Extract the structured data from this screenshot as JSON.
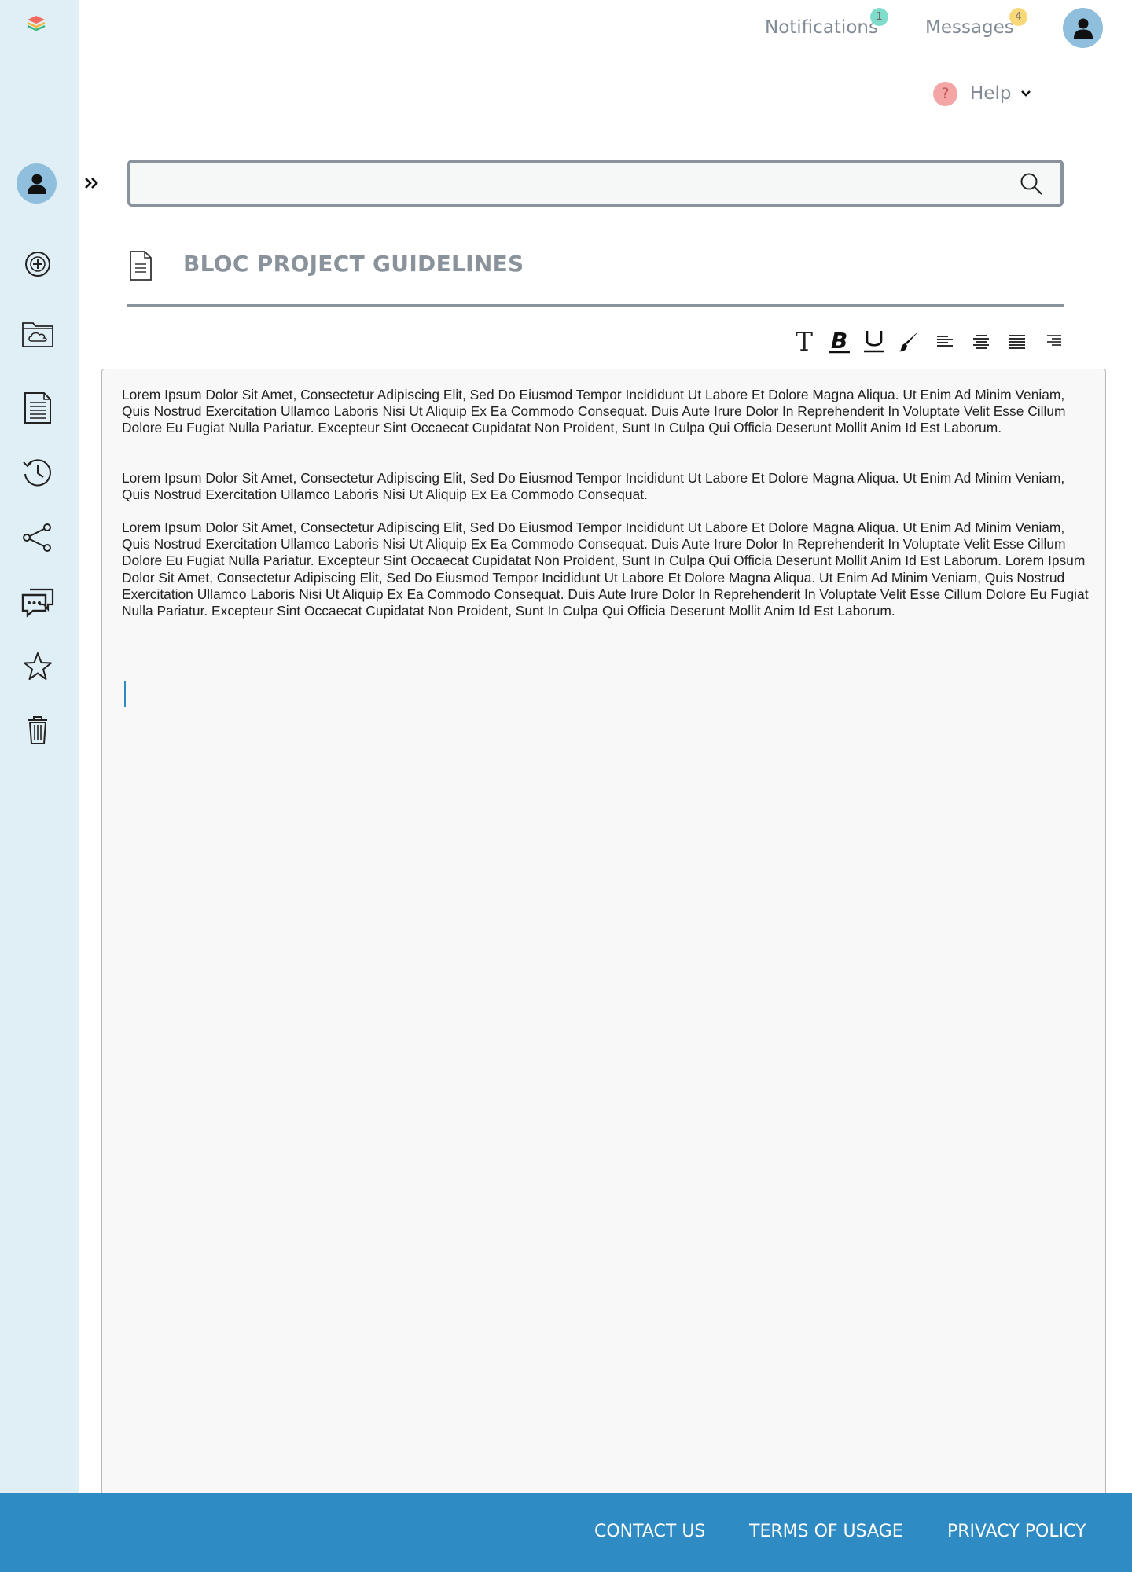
{
  "header": {
    "notifications_label": "Notifications",
    "notifications_count": "1",
    "messages_label": "Messages",
    "messages_count": "4",
    "help_label": "Help",
    "help_icon_text": "?"
  },
  "colors": {
    "sidebar_bg": "#e0eef6",
    "accent": "#2f8bc3",
    "avatar_bg": "#8fbfdc",
    "notification_badge": "#7fdccb",
    "message_badge": "#f8d878",
    "help_icon_bg": "#f4a6a6"
  },
  "sidebar": {
    "items": [
      {
        "name": "new",
        "icon": "plus-circle-icon"
      },
      {
        "name": "cloud-folder",
        "icon": "cloud-folder-icon"
      },
      {
        "name": "documents",
        "icon": "document-list-icon"
      },
      {
        "name": "history",
        "icon": "history-icon"
      },
      {
        "name": "share",
        "icon": "share-icon"
      },
      {
        "name": "chat",
        "icon": "chat-icon"
      },
      {
        "name": "favorites",
        "icon": "star-icon"
      },
      {
        "name": "trash",
        "icon": "trash-icon"
      }
    ]
  },
  "search": {
    "value": "",
    "placeholder": ""
  },
  "document": {
    "title": "BLOC PROJECT GUIDELINES",
    "paragraphs": [
      "Lorem Ipsum Dolor Sit Amet, Consectetur Adipiscing Elit, Sed Do Eiusmod Tempor Incididunt Ut Labore Et Dolore Magna Aliqua. Ut Enim Ad Minim Veniam, Quis Nostrud Exercitation Ullamco Laboris Nisi Ut Aliquip Ex Ea Commodo Consequat. Duis Aute Irure Dolor In Reprehenderit In Voluptate Velit Esse Cillum Dolore Eu Fugiat Nulla Pariatur. Excepteur Sint Occaecat Cupidatat Non Proident, Sunt In Culpa Qui Officia Deserunt Mollit Anim Id Est Laborum.",
      "Lorem Ipsum Dolor Sit Amet, Consectetur Adipiscing Elit, Sed Do Eiusmod Tempor Incididunt Ut Labore Et Dolore Magna Aliqua. Ut Enim Ad Minim Veniam, Quis Nostrud Exercitation Ullamco Laboris Nisi Ut Aliquip Ex Ea Commodo Consequat.",
      "Lorem Ipsum Dolor Sit Amet, Consectetur Adipiscing Elit, Sed Do Eiusmod Tempor Incididunt Ut Labore Et Dolore Magna Aliqua. Ut Enim Ad Minim Veniam, Quis Nostrud Exercitation Ullamco Laboris Nisi Ut Aliquip Ex Ea Commodo Consequat. Duis Aute Irure Dolor In Reprehenderit In Voluptate Velit Esse Cillum Dolore Eu Fugiat Nulla Pariatur. Excepteur Sint Occaecat Cupidatat Non Proident, Sunt In Culpa Qui Officia Deserunt Mollit Anim Id Est Laborum. Lorem Ipsum Dolor Sit Amet, Consectetur Adipiscing Elit, Sed Do Eiusmod Tempor Incididunt Ut Labore Et Dolore Magna Aliqua. Ut Enim Ad Minim Veniam, Quis Nostrud Exercitation Ullamco Laboris Nisi Ut Aliquip Ex Ea Commodo Consequat. Duis Aute Irure Dolor In Reprehenderit In Voluptate Velit Esse Cillum Dolore Eu Fugiat Nulla Pariatur. Excepteur Sint Occaecat Cupidatat Non Proident, Sunt In Culpa Qui Officia Deserunt Mollit Anim Id Est Laborum."
    ]
  },
  "toolbar": {
    "text_tool_glyph": "T",
    "tools": [
      "text-format-icon",
      "bold-icon",
      "underline-icon",
      "brush-icon",
      "align-left-icon",
      "align-center-icon",
      "align-justify-icon",
      "align-right-icon"
    ]
  },
  "footer": {
    "contact": "CONTACT US",
    "terms": "TERMS OF USAGE",
    "privacy": "PRIVACY POLICY"
  }
}
